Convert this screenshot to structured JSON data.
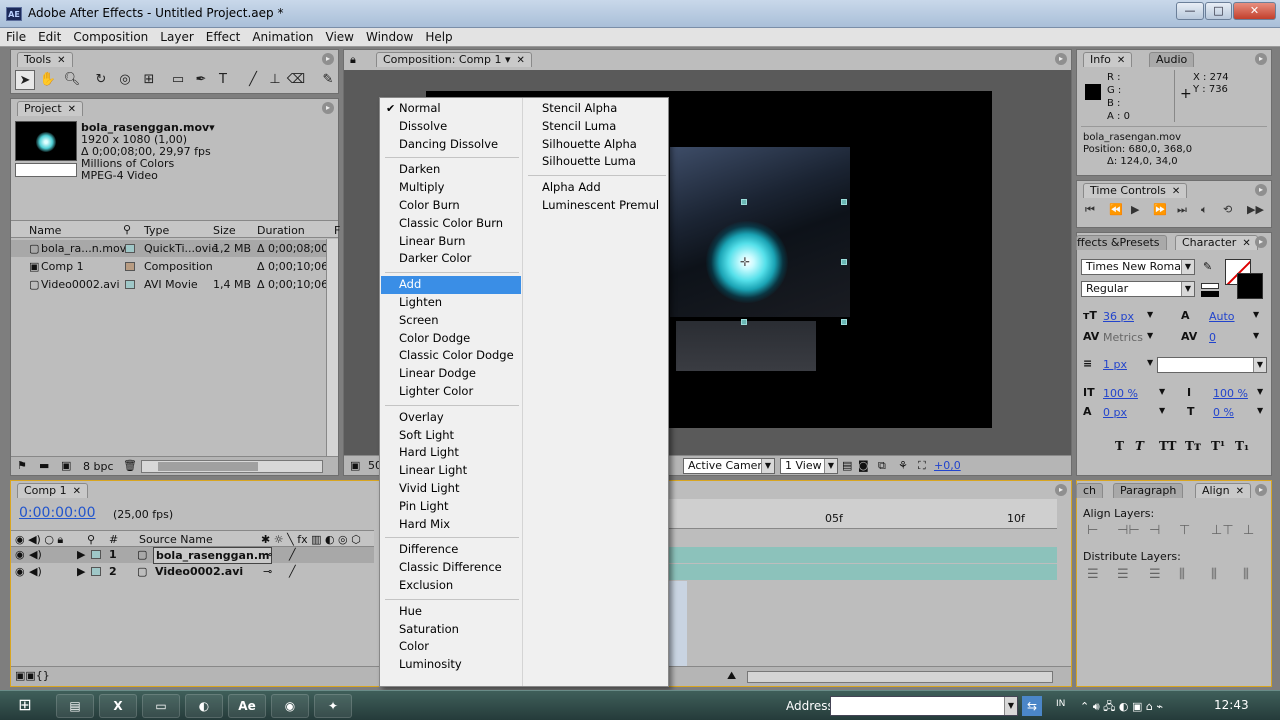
{
  "window": {
    "title": "Adobe After Effects - Untitled Project.aep *",
    "app_icon": "AE"
  },
  "window_buttons": {
    "minimize": "—",
    "maximize": "□",
    "close": "✕"
  },
  "menubar": [
    "File",
    "Edit",
    "Composition",
    "Layer",
    "Effect",
    "Animation",
    "View",
    "Window",
    "Help"
  ],
  "tools_panel": {
    "tab": "Tools"
  },
  "project_panel": {
    "tab": "Project",
    "preview": {
      "name": "bola_rasenggan.mov▾",
      "line1": "1920 x 1080 (1,00)",
      "line2": "Δ 0;00;08;00, 29,97 fps",
      "line3": "Millions of Colors",
      "line4": "MPEG-4 Video"
    },
    "columns": [
      "Name",
      "Type",
      "Size",
      "Duration",
      "F"
    ],
    "rows": [
      {
        "name": "bola_ra...n.mov",
        "type": "QuickTi...ovie",
        "size": "1,2 MB",
        "duration": "Δ 0;00;08;00",
        "color": "#9fc7c7"
      },
      {
        "name": "Comp 1",
        "type": "Composition",
        "size": "",
        "duration": "Δ 0;00;10;06",
        "color": "#b89c82"
      },
      {
        "name": "Video0002.avi",
        "type": "AVI Movie",
        "size": "1,4 MB",
        "duration": "Δ 0;00;10;06",
        "color": "#9fc7c7"
      }
    ],
    "bpc": "8 bpc"
  },
  "composition_panel": {
    "tab": "Composition: Comp 1",
    "zoom": "50",
    "camera": "Active Camera",
    "view": "1 View",
    "exposure": "+0,0"
  },
  "blend_menu": {
    "left": [
      [
        "Normal",
        "Dissolve",
        "Dancing Dissolve"
      ],
      [
        "Darken",
        "Multiply",
        "Color Burn",
        "Classic Color Burn",
        "Linear Burn",
        "Darker Color"
      ],
      [
        "Add",
        "Lighten",
        "Screen",
        "Color Dodge",
        "Classic Color Dodge",
        "Linear Dodge",
        "Lighter Color"
      ],
      [
        "Overlay",
        "Soft Light",
        "Hard Light",
        "Linear Light",
        "Vivid Light",
        "Pin Light",
        "Hard Mix"
      ],
      [
        "Difference",
        "Classic Difference",
        "Exclusion"
      ],
      [
        "Hue",
        "Saturation",
        "Color",
        "Luminosity"
      ]
    ],
    "right": [
      [
        "Stencil Alpha",
        "Stencil Luma",
        "Silhouette Alpha",
        "Silhouette Luma"
      ],
      [
        "Alpha Add",
        "Luminescent Premul"
      ]
    ],
    "checked": "Normal",
    "highlighted": "Add"
  },
  "timeline": {
    "tab": "Comp 1",
    "timecode": "0:00:00:00",
    "fps": "(25,00 fps)",
    "source_header": "Source Name",
    "hash_header": "#",
    "layers": [
      {
        "num": "1",
        "name": "bola_rasenggan.m"
      },
      {
        "num": "2",
        "name": "Video0002.avi"
      }
    ],
    "ruler": [
      "05f",
      "10f"
    ]
  },
  "info_panel": {
    "tabs": [
      "Info",
      "Audio"
    ],
    "r": "R :",
    "g": "G :",
    "b": "B :",
    "a": "A : 0",
    "x": "X : 274",
    "y": "Y : 736",
    "file": "bola_rasengan.mov",
    "position": "Position: 680,0, 368,0",
    "delta": "Δ: 124,0, 34,0"
  },
  "time_controls": {
    "tab": "Time Controls"
  },
  "character_panel": {
    "tabs": [
      "ffects &Presets",
      "Character"
    ],
    "font": "Times New Roman",
    "style": "Regular",
    "size": "36 px",
    "leading": "Auto",
    "kerning": "Metrics",
    "tracking": "0",
    "stroke": "1 px",
    "vscale": "100 %",
    "hscale": "100 %",
    "baseline": "0 px",
    "tsume": "0 %",
    "style_buttons": [
      "T",
      "T",
      "TT",
      "Tт",
      "T¹",
      "T₁"
    ]
  },
  "align_panel": {
    "tabs": [
      "ch",
      "Paragraph",
      "Align"
    ],
    "align_label": "Align Layers:",
    "distribute_label": "Distribute Layers:"
  },
  "taskbar": {
    "address_label": "Address",
    "lang": "IN",
    "clock": "12:43",
    "apps": [
      "folder-icon",
      "excel-icon",
      "window-icon",
      "paint-icon",
      "after-effects-icon",
      "chrome-icon",
      "green-app-icon"
    ],
    "app_glyphs": [
      "▤",
      "X",
      "▭",
      "◐",
      "Ae",
      "◉",
      "✦"
    ]
  }
}
